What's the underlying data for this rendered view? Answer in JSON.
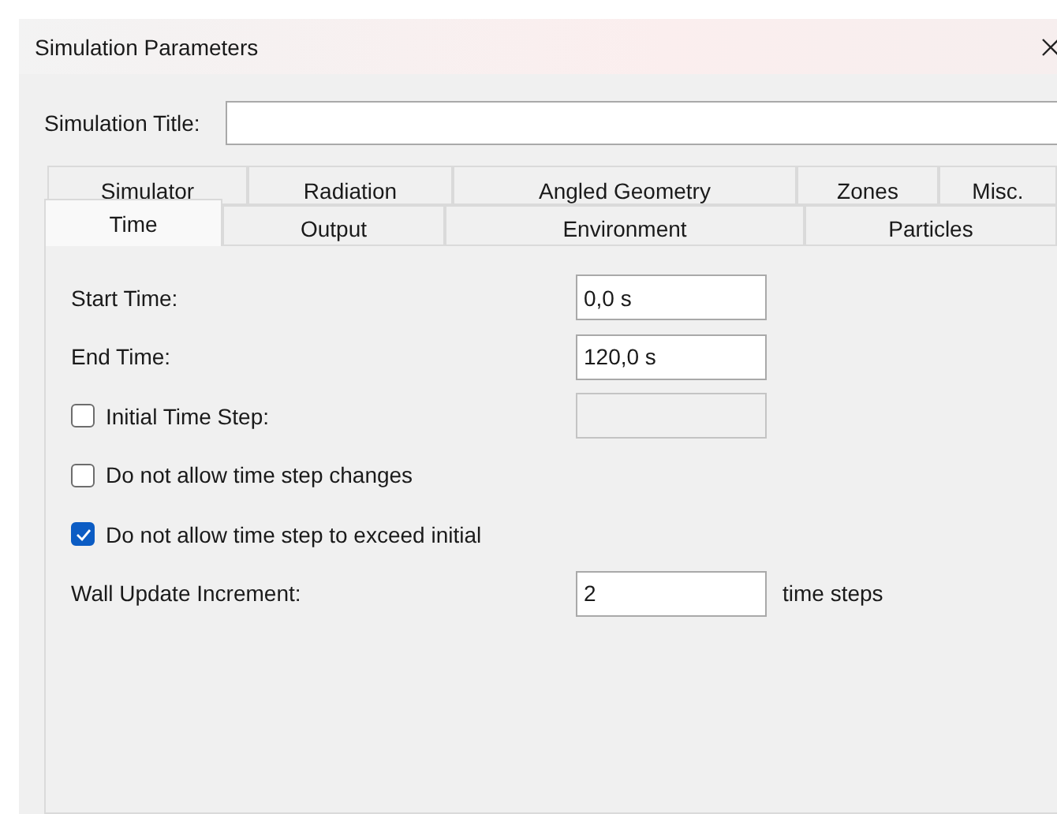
{
  "window": {
    "title": "Simulation Parameters"
  },
  "simulation_title": {
    "label": "Simulation Title:"
  },
  "tab_rows": [
    [
      {
        "label": "Simulator",
        "selected": false
      },
      {
        "label": "Radiation",
        "selected": false
      },
      {
        "label": "Angled Geometry",
        "selected": false
      },
      {
        "label": "Zones",
        "selected": false
      },
      {
        "label": "Misc.",
        "selected": false
      }
    ],
    [
      {
        "label": "Time",
        "selected": true
      },
      {
        "label": "Output",
        "selected": false
      },
      {
        "label": "Environment",
        "selected": false
      },
      {
        "label": "Particles",
        "selected": false
      }
    ]
  ],
  "fields": [
    {
      "kind": "text",
      "label": "Start Time:",
      "value": "0,0 s"
    },
    {
      "kind": "text",
      "label": "End Time:",
      "value": "120,0 s"
    },
    {
      "kind": "check-input",
      "label": "Initial Time Step:",
      "checked": false,
      "disabled": true
    },
    {
      "kind": "check",
      "label": "Do not allow time step changes",
      "checked": false
    },
    {
      "kind": "check",
      "label": "Do not allow time step to exceed initial",
      "checked": true
    },
    {
      "kind": "text",
      "label": "Wall Update Increment:",
      "value": "2",
      "unit": "time steps"
    }
  ]
}
